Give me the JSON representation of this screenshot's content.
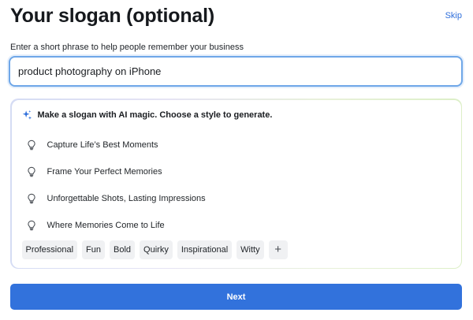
{
  "header": {
    "title": "Your slogan (optional)",
    "skip_label": "Skip"
  },
  "slogan_field": {
    "label": "Enter a short phrase to help people remember your business",
    "value": "product photography on iPhone"
  },
  "ai_panel": {
    "heading": "Make a slogan with AI magic. Choose a style to generate.",
    "heading_icon": "sparkles-icon",
    "suggestion_icon": "lightbulb-icon",
    "suggestions": [
      "Capture Life’s Best Moments",
      "Frame Your Perfect Memories",
      "Unforgettable Shots, Lasting Impressions",
      "Where Memories Come to Life"
    ],
    "styles": [
      "Professional",
      "Fun",
      "Bold",
      "Quirky",
      "Inspirational",
      "Witty"
    ],
    "add_style_label": "+"
  },
  "footer": {
    "next_label": "Next"
  },
  "colors": {
    "accent": "#3272dc",
    "link": "#2f6fdb",
    "input_focus_border": "#6fa7e8",
    "chip_bg": "#f0f1f3"
  }
}
